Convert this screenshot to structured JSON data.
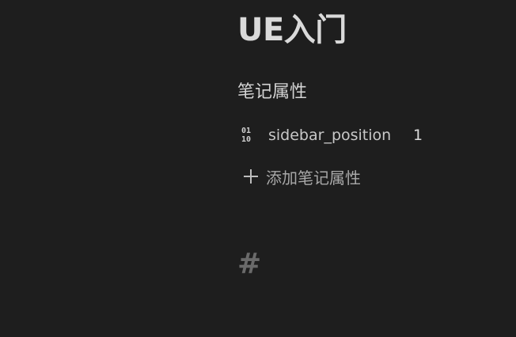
{
  "note": {
    "title": "UE入门",
    "properties_heading": "笔记属性",
    "properties": [
      {
        "icon": "number-icon",
        "icon_glyph_top": "01",
        "icon_glyph_bottom": "10",
        "key": "sidebar_position",
        "value": "1"
      }
    ],
    "add_property_label": "添加笔记属性",
    "add_property_icon": "plus-icon",
    "heading_marker": "#"
  },
  "colors": {
    "background": "#1e1e1e",
    "text": "#dadada",
    "muted": "#a8a8a8",
    "heading_marker": "#6a6a6a"
  }
}
